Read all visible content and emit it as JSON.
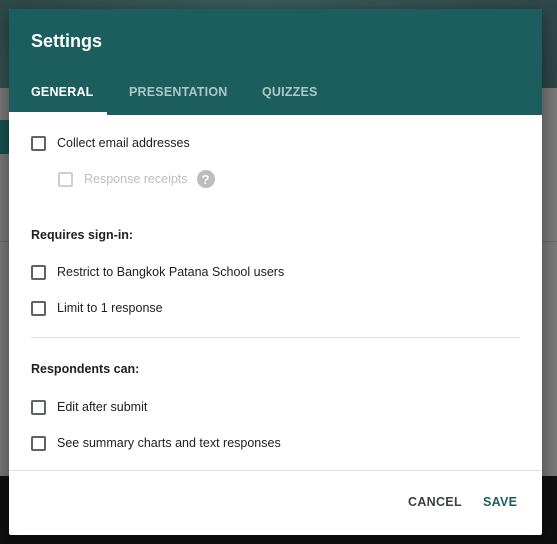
{
  "dialog": {
    "title": "Settings",
    "tabs": [
      {
        "label": "GENERAL",
        "active": true
      },
      {
        "label": "PRESENTATION",
        "active": false
      },
      {
        "label": "QUIZZES",
        "active": false
      }
    ],
    "options": {
      "collect_email": "Collect email addresses",
      "response_receipts": "Response receipts"
    },
    "requires_signin": {
      "heading": "Requires sign-in:",
      "restrict": "Restrict to Bangkok Patana School users",
      "limit": "Limit to 1 response"
    },
    "respondents": {
      "heading": "Respondents can:",
      "edit": "Edit after submit",
      "summary": "See summary charts and text responses"
    },
    "buttons": {
      "cancel": "CANCEL",
      "save": "SAVE"
    }
  },
  "colors": {
    "header": "#1b5e5d",
    "accent": "#1b5e5d"
  },
  "icons": {
    "help": "?"
  }
}
